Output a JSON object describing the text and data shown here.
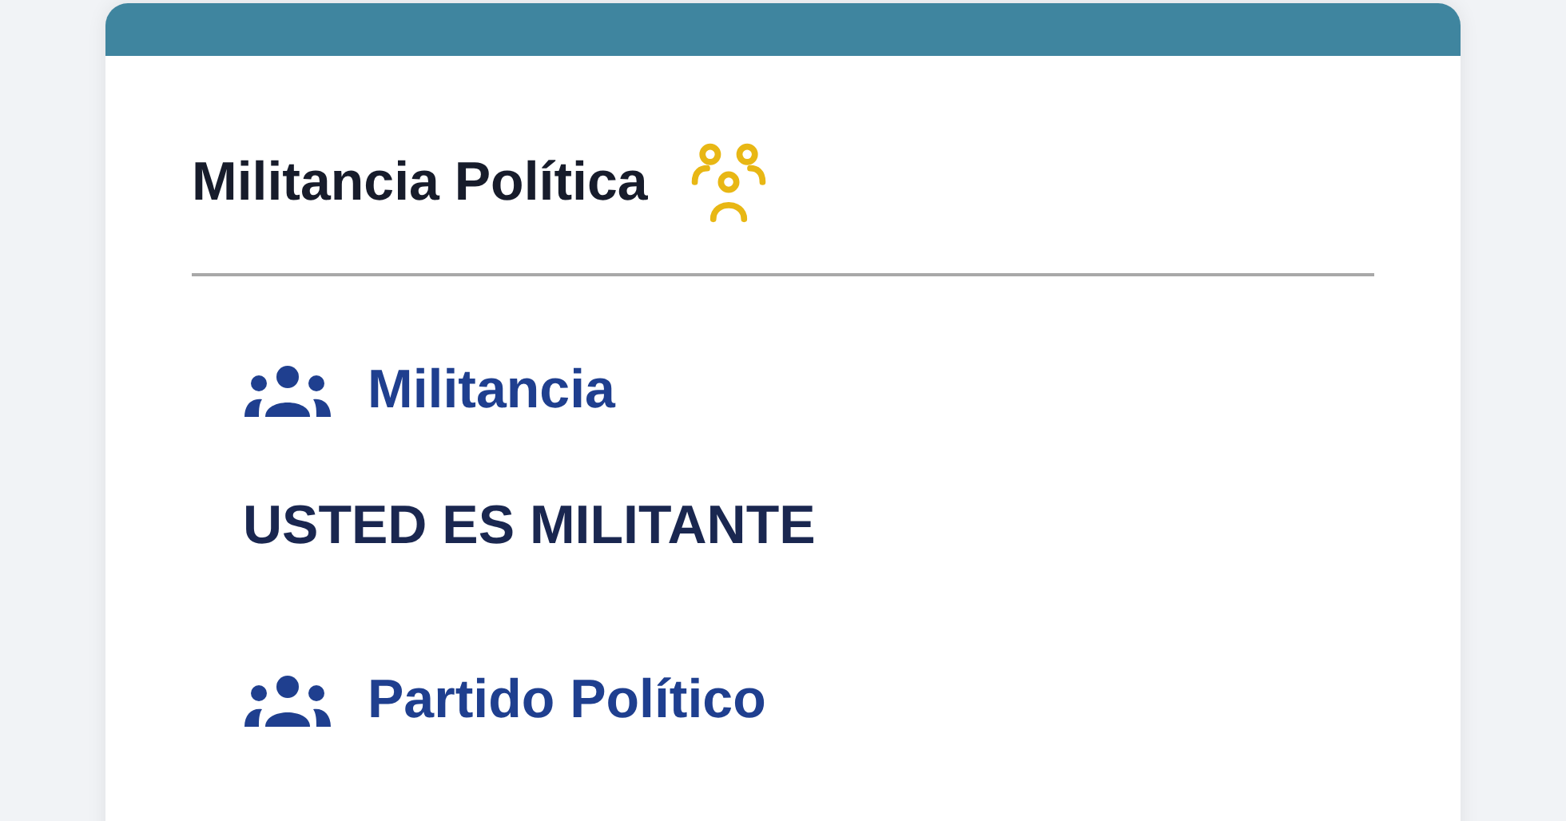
{
  "card": {
    "title": "Militancia Política",
    "sections": [
      {
        "label": "Militancia",
        "value": "USTED ES MILITANTE"
      },
      {
        "label": "Partido Político"
      }
    ]
  }
}
